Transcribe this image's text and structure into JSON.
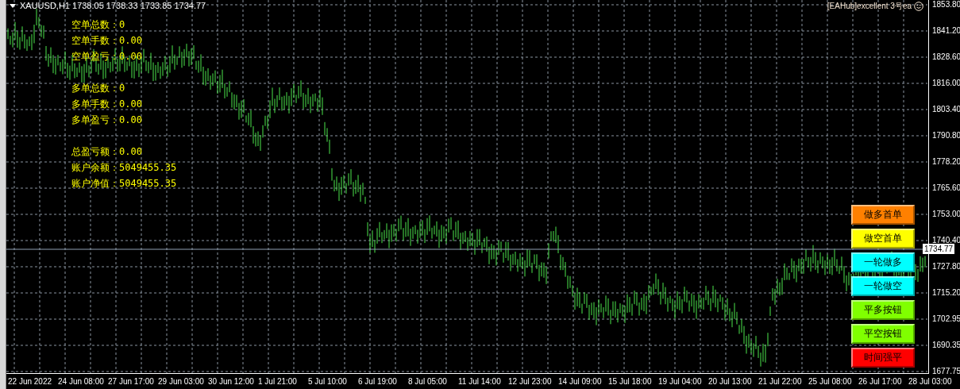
{
  "chart": {
    "title": "XAUUSD,H1  1738.05 1738.33 1733.85 1734.77",
    "ea_label": "[EAHub]excellent  3号ea",
    "current_price": "1734.77",
    "price_axis": [
      "1853.80",
      "1841.20",
      "1828.60",
      "1816.00",
      "1803.40",
      "1790.80",
      "1778.20",
      "1765.60",
      "1753.00",
      "1740.40",
      "1727.80",
      "1715.20",
      "1702.95",
      "1690.35",
      "1677.75"
    ],
    "time_axis": [
      "22 Jun 2022",
      "24 Jun 08:00",
      "27 Jun 17:00",
      "29 Jun 03:00",
      "30 Jun 12:00",
      "1 Jul 21:00",
      "5 Jul 10:00",
      "6 Jul 19:00",
      "8 Jul 05:00",
      "11 Jul 14:00",
      "12 Jul 23:00",
      "14 Jul 09:00",
      "15 Jul 18:00",
      "19 Jul 04:00",
      "20 Jul 13:00",
      "21 Jul 22:00",
      "25 Jul 08:00",
      "26 Jul 17:00",
      "28 Jul 03:00"
    ]
  },
  "stat_groups": [
    {
      "lines": [
        "空单总数：0",
        "空单手数：0.00",
        "空单盈亏：0.00"
      ]
    },
    {
      "lines": [
        "多单总数：0",
        "多单手数：0.00",
        "多单盈亏：0.00"
      ]
    },
    {
      "lines": [
        "总盈亏额：0.00",
        "账户余额：5049455.35",
        "账户净值：5049455.35"
      ]
    }
  ],
  "buttons": [
    {
      "label": "做多首单",
      "color": "#ff8000"
    },
    {
      "label": "做空首单",
      "color": "#ffff00"
    },
    {
      "label": "一轮做多",
      "color": "#00ffff"
    },
    {
      "label": "一轮做空",
      "color": "#00ffff"
    },
    {
      "label": "平多按钮",
      "color": "#80ff00"
    },
    {
      "label": "平空按钮",
      "color": "#80ff00"
    },
    {
      "label": "时间强平",
      "color": "#ff0000"
    }
  ]
}
